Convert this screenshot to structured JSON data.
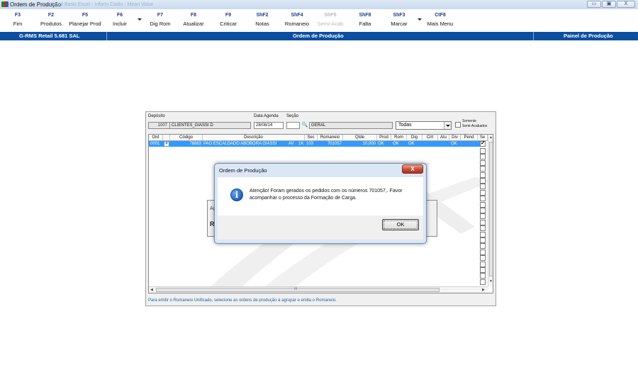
{
  "window": {
    "title": "Ordem de Produção",
    "ghost_text": "Visual Basic Excel   - Inform Códio - Mean Value",
    "controls": {
      "minimize": "▭",
      "maximize": "▣",
      "close": "X"
    }
  },
  "toolbar": {
    "items": [
      {
        "key": "F3",
        "label": "Fim",
        "enabled": true
      },
      {
        "key": "F2",
        "label": "Produtos",
        "enabled": true
      },
      {
        "key": "F5",
        "label": "Planejar Prod",
        "enabled": true
      },
      {
        "key": "F6",
        "label": "Incluir",
        "enabled": true
      },
      {
        "key": "F7",
        "label": "Dig Rom",
        "enabled": true
      },
      {
        "key": "F8",
        "label": "Atualizar",
        "enabled": true
      },
      {
        "key": "F9",
        "label": "Criticar",
        "enabled": true
      },
      {
        "key": "ShF2",
        "label": "Notas",
        "enabled": true
      },
      {
        "key": "ShF4",
        "label": "Romaneio",
        "enabled": true
      },
      {
        "key": "ShF5",
        "label": "Semi-Acab",
        "enabled": false
      },
      {
        "key": "ShF8",
        "label": "Falta",
        "enabled": true
      },
      {
        "key": "ShF3",
        "label": "Marcar",
        "enabled": true
      },
      {
        "key": "CtF8",
        "label": "Mais Menu",
        "enabled": true
      }
    ]
  },
  "status_bar": {
    "app_version": "G-RMS Retail 5.681 SAL",
    "screen_title": "Ordem de Produção",
    "right_panel": "Painel de Produção"
  },
  "form": {
    "deposito_label": "Depósito",
    "deposito_code": "1007",
    "deposito_name": "CLIENTES_GIASSI D",
    "data_agenda_label": "Data Agenda",
    "data_agenda": "28/08/14",
    "secao_label": "Seção",
    "secao_code": "",
    "secao_name": "GERAL",
    "filter_value": "Todas",
    "somente_label_1": "Somente",
    "somente_label_2": "Semi-Acabados",
    "somente_checked": false
  },
  "grid": {
    "columns": [
      "Ord",
      "",
      "Código",
      "Descrição",
      "Sec",
      "Romaneio",
      "Qtde",
      "Prod",
      "Rom",
      "Dig",
      "Crit",
      "Atu",
      "Div",
      "Pend",
      "Se"
    ],
    "rows": [
      {
        "ord": "0001",
        "codigo": "78883",
        "descricao": "PAO ESCALDADO ABOBORA GIASSI",
        "un": "AV",
        "emb": "1K",
        "sec": "103",
        "romaneio": "701057",
        "qtde": "10,000",
        "prod": "OK",
        "rom": "OK",
        "dig": "OK",
        "crit": "",
        "atu": "",
        "div": "OK",
        "pend": "",
        "selected": true
      }
    ],
    "empty_checkbox_rows": 23,
    "hscroll_mark": "III"
  },
  "behind_dialog": {
    "title_fragment": "Ag",
    "bold_fragment": "R"
  },
  "footer_info": "Para emitir o Romaneio Unificado, selecione as ordens de produção à agrupar e emita o Romaneio.",
  "dialog": {
    "title": "Ordem de Produção",
    "close_label": "X",
    "icon": "info-icon",
    "message": "Atenção! Foram gerados os pedidos com os números 701057,. Favor acompanhar o processo da Formação de Carga.",
    "ok_label": "OK"
  },
  "colors": {
    "status_bar": "#0b4ea2",
    "selected_row": "#3399ff",
    "toolbar_key": "#1e3a8a",
    "info_text": "#1f5fa8"
  }
}
